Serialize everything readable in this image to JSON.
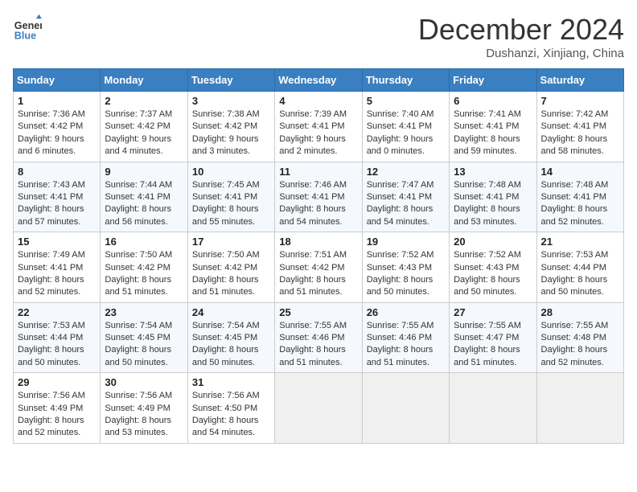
{
  "header": {
    "logo_line1": "General",
    "logo_line2": "Blue",
    "month": "December 2024",
    "location": "Dushanzi, Xinjiang, China"
  },
  "weekdays": [
    "Sunday",
    "Monday",
    "Tuesday",
    "Wednesday",
    "Thursday",
    "Friday",
    "Saturday"
  ],
  "weeks": [
    [
      {
        "day": "1",
        "sunrise": "7:36 AM",
        "sunset": "4:42 PM",
        "daylight": "9 hours and 6 minutes."
      },
      {
        "day": "2",
        "sunrise": "7:37 AM",
        "sunset": "4:42 PM",
        "daylight": "9 hours and 4 minutes."
      },
      {
        "day": "3",
        "sunrise": "7:38 AM",
        "sunset": "4:42 PM",
        "daylight": "9 hours and 3 minutes."
      },
      {
        "day": "4",
        "sunrise": "7:39 AM",
        "sunset": "4:41 PM",
        "daylight": "9 hours and 2 minutes."
      },
      {
        "day": "5",
        "sunrise": "7:40 AM",
        "sunset": "4:41 PM",
        "daylight": "9 hours and 0 minutes."
      },
      {
        "day": "6",
        "sunrise": "7:41 AM",
        "sunset": "4:41 PM",
        "daylight": "8 hours and 59 minutes."
      },
      {
        "day": "7",
        "sunrise": "7:42 AM",
        "sunset": "4:41 PM",
        "daylight": "8 hours and 58 minutes."
      }
    ],
    [
      {
        "day": "8",
        "sunrise": "7:43 AM",
        "sunset": "4:41 PM",
        "daylight": "8 hours and 57 minutes."
      },
      {
        "day": "9",
        "sunrise": "7:44 AM",
        "sunset": "4:41 PM",
        "daylight": "8 hours and 56 minutes."
      },
      {
        "day": "10",
        "sunrise": "7:45 AM",
        "sunset": "4:41 PM",
        "daylight": "8 hours and 55 minutes."
      },
      {
        "day": "11",
        "sunrise": "7:46 AM",
        "sunset": "4:41 PM",
        "daylight": "8 hours and 54 minutes."
      },
      {
        "day": "12",
        "sunrise": "7:47 AM",
        "sunset": "4:41 PM",
        "daylight": "8 hours and 54 minutes."
      },
      {
        "day": "13",
        "sunrise": "7:48 AM",
        "sunset": "4:41 PM",
        "daylight": "8 hours and 53 minutes."
      },
      {
        "day": "14",
        "sunrise": "7:48 AM",
        "sunset": "4:41 PM",
        "daylight": "8 hours and 52 minutes."
      }
    ],
    [
      {
        "day": "15",
        "sunrise": "7:49 AM",
        "sunset": "4:41 PM",
        "daylight": "8 hours and 52 minutes."
      },
      {
        "day": "16",
        "sunrise": "7:50 AM",
        "sunset": "4:42 PM",
        "daylight": "8 hours and 51 minutes."
      },
      {
        "day": "17",
        "sunrise": "7:50 AM",
        "sunset": "4:42 PM",
        "daylight": "8 hours and 51 minutes."
      },
      {
        "day": "18",
        "sunrise": "7:51 AM",
        "sunset": "4:42 PM",
        "daylight": "8 hours and 51 minutes."
      },
      {
        "day": "19",
        "sunrise": "7:52 AM",
        "sunset": "4:43 PM",
        "daylight": "8 hours and 50 minutes."
      },
      {
        "day": "20",
        "sunrise": "7:52 AM",
        "sunset": "4:43 PM",
        "daylight": "8 hours and 50 minutes."
      },
      {
        "day": "21",
        "sunrise": "7:53 AM",
        "sunset": "4:44 PM",
        "daylight": "8 hours and 50 minutes."
      }
    ],
    [
      {
        "day": "22",
        "sunrise": "7:53 AM",
        "sunset": "4:44 PM",
        "daylight": "8 hours and 50 minutes."
      },
      {
        "day": "23",
        "sunrise": "7:54 AM",
        "sunset": "4:45 PM",
        "daylight": "8 hours and 50 minutes."
      },
      {
        "day": "24",
        "sunrise": "7:54 AM",
        "sunset": "4:45 PM",
        "daylight": "8 hours and 50 minutes."
      },
      {
        "day": "25",
        "sunrise": "7:55 AM",
        "sunset": "4:46 PM",
        "daylight": "8 hours and 51 minutes."
      },
      {
        "day": "26",
        "sunrise": "7:55 AM",
        "sunset": "4:46 PM",
        "daylight": "8 hours and 51 minutes."
      },
      {
        "day": "27",
        "sunrise": "7:55 AM",
        "sunset": "4:47 PM",
        "daylight": "8 hours and 51 minutes."
      },
      {
        "day": "28",
        "sunrise": "7:55 AM",
        "sunset": "4:48 PM",
        "daylight": "8 hours and 52 minutes."
      }
    ],
    [
      {
        "day": "29",
        "sunrise": "7:56 AM",
        "sunset": "4:49 PM",
        "daylight": "8 hours and 52 minutes."
      },
      {
        "day": "30",
        "sunrise": "7:56 AM",
        "sunset": "4:49 PM",
        "daylight": "8 hours and 53 minutes."
      },
      {
        "day": "31",
        "sunrise": "7:56 AM",
        "sunset": "4:50 PM",
        "daylight": "8 hours and 54 minutes."
      },
      null,
      null,
      null,
      null
    ]
  ]
}
